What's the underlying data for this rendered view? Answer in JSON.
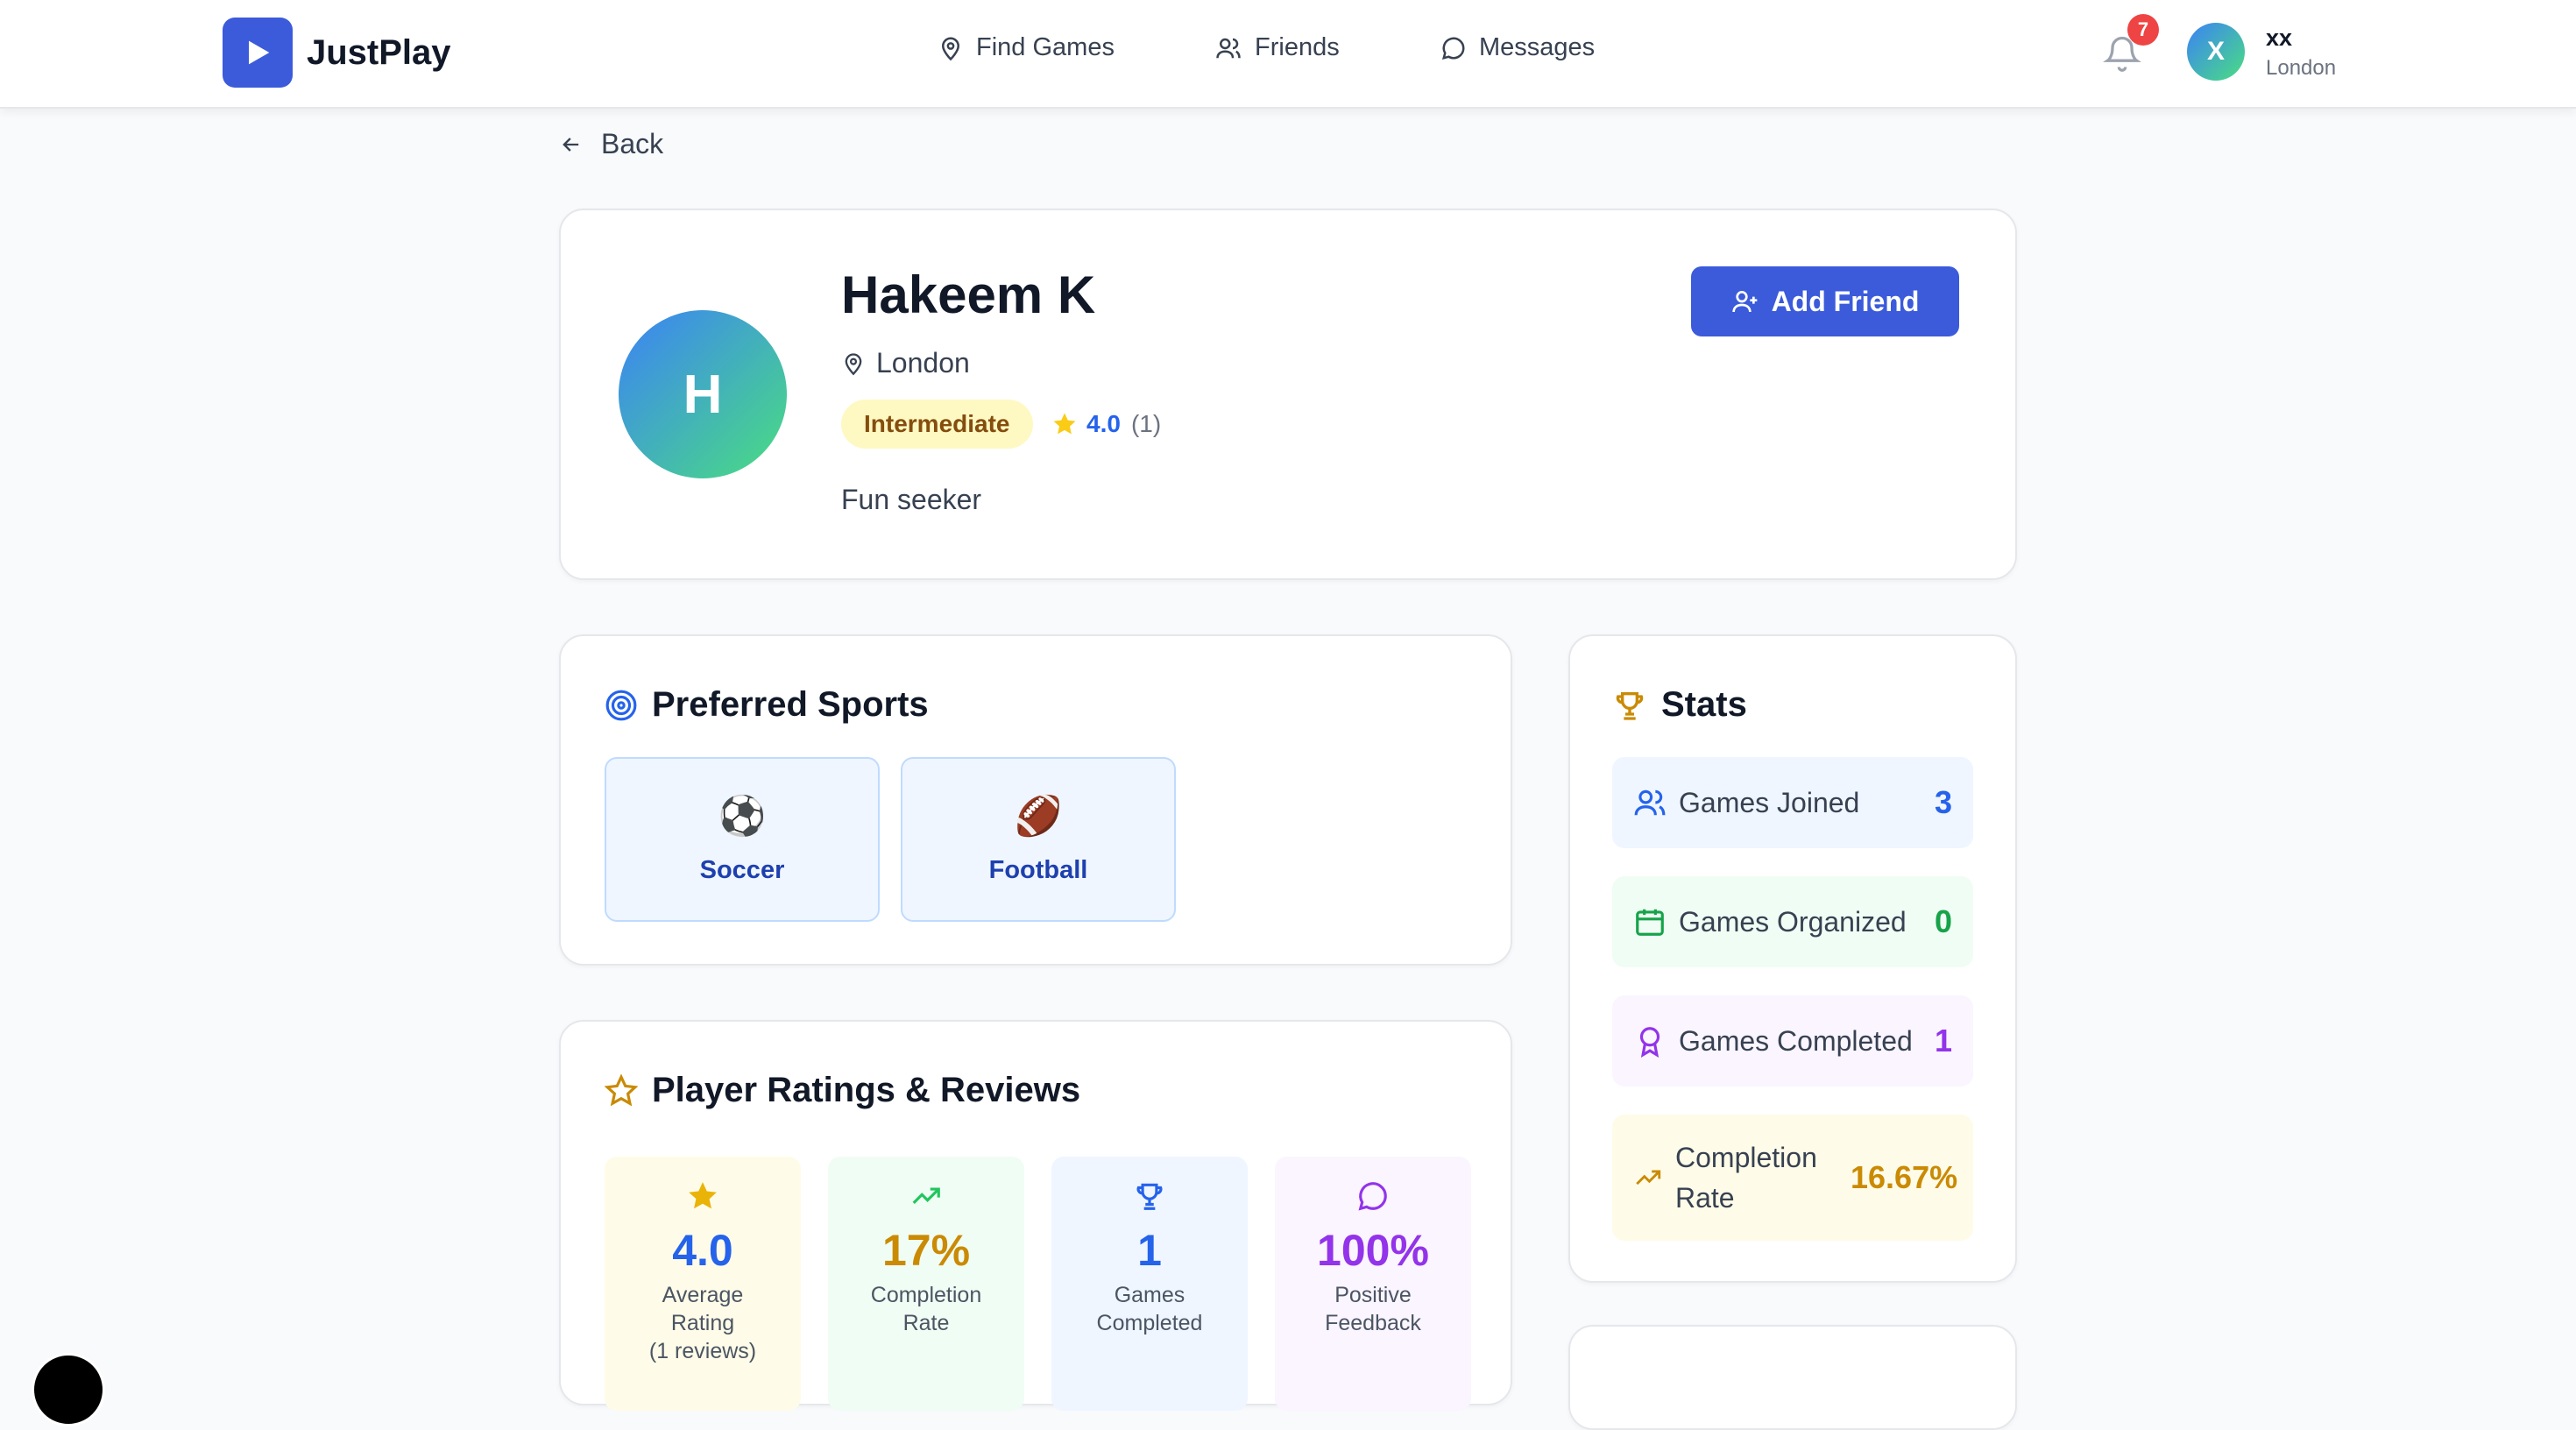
{
  "brand": {
    "name": "JustPlay",
    "accent": "#3b5bdb"
  },
  "nav": {
    "links": [
      {
        "label": "Find Games",
        "icon": "map-pin-icon"
      },
      {
        "label": "Friends",
        "icon": "users-icon"
      },
      {
        "label": "Messages",
        "icon": "message-icon"
      }
    ],
    "notifications": 7,
    "user": {
      "initial": "X",
      "name": "xx",
      "location": "London"
    }
  },
  "back_label": "Back",
  "profile": {
    "initial": "H",
    "name": "Hakeem K",
    "location": "London",
    "level": "Intermediate",
    "rating": "4.0",
    "rating_count": "(1)",
    "bio": "Fun seeker",
    "add_friend_label": "Add Friend"
  },
  "preferred_sports": {
    "title": "Preferred Sports",
    "items": [
      {
        "emoji": "⚽",
        "label": "Soccer"
      },
      {
        "emoji": "🏈",
        "label": "Football"
      }
    ]
  },
  "ratings": {
    "title": "Player Ratings & Reviews",
    "tiles": [
      {
        "value": "4.0",
        "caption_lines": [
          "Average",
          "Rating",
          "(1 reviews)"
        ],
        "color": "#2563eb",
        "bg": "#fefce8",
        "icon": "star-icon"
      },
      {
        "value": "17%",
        "caption_lines": [
          "Completion",
          "Rate"
        ],
        "color": "#ca8a04",
        "bg": "#f0fdf4",
        "icon": "trending-up-icon"
      },
      {
        "value": "1",
        "caption_lines": [
          "Games",
          "Completed"
        ],
        "color": "#2563eb",
        "bg": "#eff6ff",
        "icon": "trophy-icon"
      },
      {
        "value": "100%",
        "caption_lines": [
          "Positive",
          "Feedback"
        ],
        "color": "#9333ea",
        "bg": "#faf5ff",
        "icon": "message-icon"
      }
    ]
  },
  "stats": {
    "title": "Stats",
    "items": [
      {
        "label": "Games Joined",
        "value": "3",
        "color": "#2563eb",
        "bg": "#eff6ff",
        "icon": "users-icon"
      },
      {
        "label": "Games Organized",
        "value": "0",
        "color": "#16a34a",
        "bg": "#f0fdf4",
        "icon": "calendar-icon"
      },
      {
        "label": "Games Completed",
        "value": "1",
        "color": "#9333ea",
        "bg": "#faf5ff",
        "icon": "award-icon"
      },
      {
        "label": "Completion Rate",
        "value": "16.67%",
        "color": "#ca8a04",
        "bg": "#fefce8",
        "icon": "trending-up-icon"
      }
    ]
  }
}
